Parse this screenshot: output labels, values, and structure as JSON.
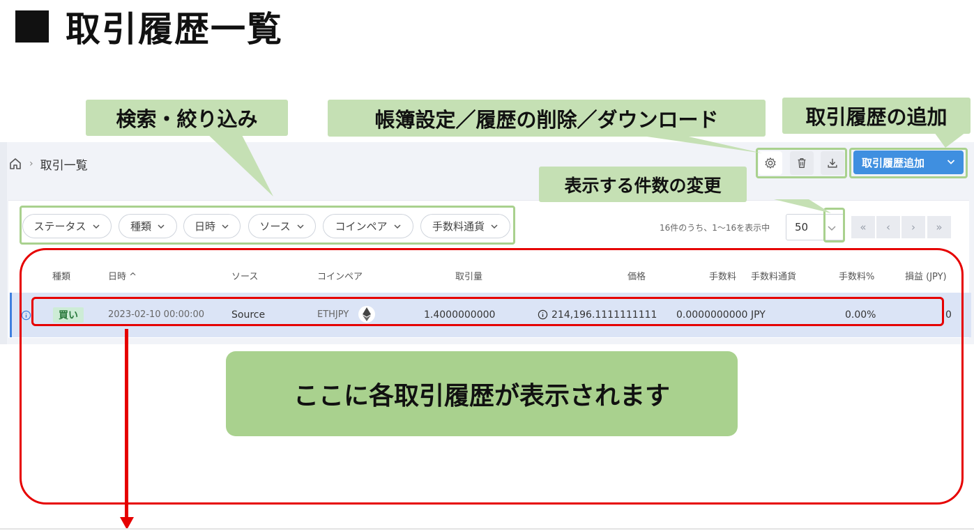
{
  "slide_title": "取引履歴一覧",
  "callouts": {
    "search": "検索・絞り込み",
    "ledger_tools": "帳簿設定／履歴の削除／ダウンロード",
    "add_history": "取引履歴の追加",
    "per_page": "表示する件数の変更",
    "main": "ここに各取引履歴が表示されます"
  },
  "breadcrumb": {
    "separator": "›",
    "current": "取引一覧"
  },
  "toolbar": {
    "add_button_label": "取引履歴追加"
  },
  "filters": [
    "ステータス",
    "種類",
    "日時",
    "ソース",
    "コインペア",
    "手数料通貨"
  ],
  "pagination": {
    "count_text": "16件のうち、1〜16を表示中",
    "per_page": "50",
    "first": "«",
    "prev": "‹",
    "next": "›",
    "last": "»"
  },
  "table": {
    "headers": {
      "type": "種類",
      "datetime": "日時 ^",
      "source": "ソース",
      "pair": "コインペア",
      "amount": "取引量",
      "price": "価格",
      "fee": "手数料",
      "fee_currency": "手数料通貨",
      "fee_pct": "手数料%",
      "pnl": "損益 (JPY)"
    },
    "rows": [
      {
        "type": "買い",
        "datetime": "2023-02-10 00:00:00",
        "source": "Source",
        "pair": "ETHJPY",
        "amount": "1.4000000000",
        "price": "214,196.1111111111",
        "fee": "0.0000000000",
        "fee_currency": "JPY",
        "fee_pct": "0.00%",
        "pnl": "0"
      }
    ]
  },
  "colors": {
    "callout_green": "#c5e0b4",
    "callout_big": "#a9d18e",
    "highlight_red": "#e60000",
    "primary_blue": "#3f8fe0",
    "row_selected": "#dbe4f6",
    "buy_badge_bg": "#cdecd6"
  }
}
